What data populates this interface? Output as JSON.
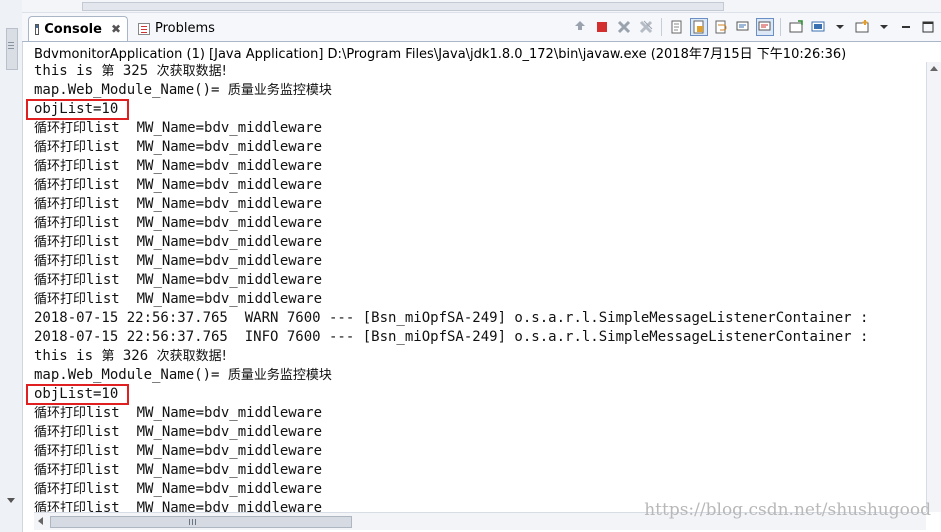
{
  "tabs": {
    "console_label": "Console",
    "console_close": "✖",
    "problems_label": "Problems"
  },
  "process_title": "BdvmonitorApplication (1) [Java Application] D:\\Program Files\\Java\\jdk1.8.0_172\\bin\\javaw.exe (2018年7月15日 下午10:26:36)",
  "console_lines": [
    {
      "mono": "this is ",
      "zh": "第",
      "mono2": " 325 ",
      "zh2": "次获取数据!"
    },
    {
      "mono": "map.Web_Module_Name()= ",
      "zh": "质量业务监控模块",
      "mono2": "",
      "zh2": ""
    },
    {
      "mono": "objList=10",
      "zh": "",
      "mono2": "",
      "zh2": ""
    },
    {
      "mono": "",
      "zh": "循环打印",
      "mono2": "list  MW_Name=bdv_middleware",
      "zh2": ""
    },
    {
      "mono": "",
      "zh": "循环打印",
      "mono2": "list  MW_Name=bdv_middleware",
      "zh2": ""
    },
    {
      "mono": "",
      "zh": "循环打印",
      "mono2": "list  MW_Name=bdv_middleware",
      "zh2": ""
    },
    {
      "mono": "",
      "zh": "循环打印",
      "mono2": "list  MW_Name=bdv_middleware",
      "zh2": ""
    },
    {
      "mono": "",
      "zh": "循环打印",
      "mono2": "list  MW_Name=bdv_middleware",
      "zh2": ""
    },
    {
      "mono": "",
      "zh": "循环打印",
      "mono2": "list  MW_Name=bdv_middleware",
      "zh2": ""
    },
    {
      "mono": "",
      "zh": "循环打印",
      "mono2": "list  MW_Name=bdv_middleware",
      "zh2": ""
    },
    {
      "mono": "",
      "zh": "循环打印",
      "mono2": "list  MW_Name=bdv_middleware",
      "zh2": ""
    },
    {
      "mono": "",
      "zh": "循环打印",
      "mono2": "list  MW_Name=bdv_middleware",
      "zh2": ""
    },
    {
      "mono": "",
      "zh": "循环打印",
      "mono2": "list  MW_Name=bdv_middleware",
      "zh2": ""
    },
    {
      "mono": "2018-07-15 22:56:37.765  WARN 7600 --- [Bsn_miOpfSA-249] o.s.a.r.l.SimpleMessageListenerContainer :",
      "zh": "",
      "mono2": "",
      "zh2": ""
    },
    {
      "mono": "2018-07-15 22:56:37.765  INFO 7600 --- [Bsn_miOpfSA-249] o.s.a.r.l.SimpleMessageListenerContainer :",
      "zh": "",
      "mono2": "",
      "zh2": ""
    },
    {
      "mono": "this is ",
      "zh": "第",
      "mono2": " 326 ",
      "zh2": "次获取数据!"
    },
    {
      "mono": "map.Web_Module_Name()= ",
      "zh": "质量业务监控模块",
      "mono2": "",
      "zh2": ""
    },
    {
      "mono": "objList=10",
      "zh": "",
      "mono2": "",
      "zh2": ""
    },
    {
      "mono": "",
      "zh": "循环打印",
      "mono2": "list  MW_Name=bdv_middleware",
      "zh2": ""
    },
    {
      "mono": "",
      "zh": "循环打印",
      "mono2": "list  MW_Name=bdv_middleware",
      "zh2": ""
    },
    {
      "mono": "",
      "zh": "循环打印",
      "mono2": "list  MW_Name=bdv_middleware",
      "zh2": ""
    },
    {
      "mono": "",
      "zh": "循环打印",
      "mono2": "list  MW_Name=bdv_middleware",
      "zh2": ""
    },
    {
      "mono": "",
      "zh": "循环打印",
      "mono2": "list  MW_Name=bdv_middleware",
      "zh2": ""
    },
    {
      "mono": "",
      "zh": "循环打印",
      "mono2": "list  MW_Name=bdv_middleware",
      "zh2": ""
    }
  ],
  "highlighted_lines": [
    2,
    17
  ],
  "highlight_color": "#e02020",
  "toolbar_icons": [
    "pin-icon",
    "terminate-icon",
    "remove-launch-icon",
    "remove-all-icon",
    "clear-console-icon",
    "scroll-lock-icon",
    "word-wrap-icon",
    "show-on-stdout-icon",
    "show-on-stderr-icon",
    "open-console-icon",
    "new-console-view-icon",
    "display-console-icon",
    "minimize-icon",
    "maximize-icon"
  ],
  "watermark": "https://blog.csdn.net/shushugood"
}
